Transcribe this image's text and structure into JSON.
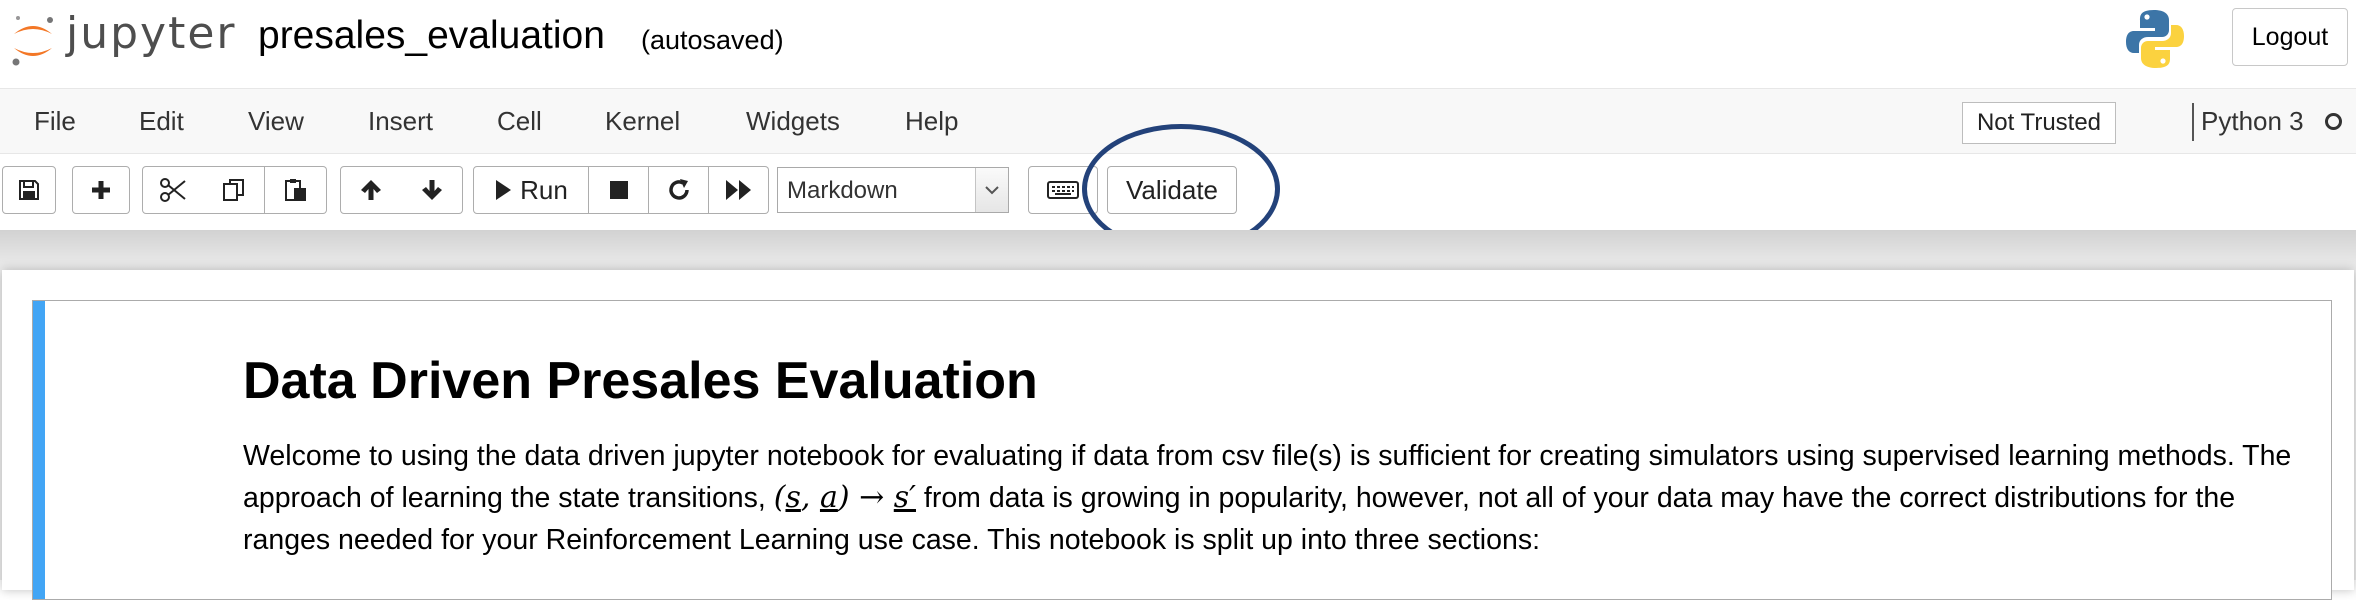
{
  "header": {
    "logo_text": "jupyter",
    "notebook_name": "presales_evaluation",
    "autosave_status": "(autosaved)",
    "logout_label": "Logout"
  },
  "menubar": {
    "items": [
      "File",
      "Edit",
      "View",
      "Insert",
      "Cell",
      "Kernel",
      "Widgets",
      "Help"
    ],
    "trust_label": "Not Trusted",
    "kernel_name": "Python 3"
  },
  "toolbar": {
    "run_label": "Run",
    "cell_type": "Markdown",
    "validate_label": "Validate"
  },
  "cell": {
    "heading": "Data Driven Presales Evaluation",
    "para_part1": "Welcome to using the data driven jupyter notebook for evaluating if data from csv file(s) is sufficient for creating simulators using supervised learning methods. The approach of learning the state transitions,",
    "math_s": "s",
    "math_a": "a",
    "math_s_prime": "s′",
    "para_part2": "from data is growing in popularity, however, not all of your data may have the correct distributions for the ranges needed for your Reinforcement Learning use case. This notebook is split up into three sections:"
  },
  "colors": {
    "accent_cell_selected": "#42a5f5",
    "highlight_ring": "#23427a",
    "jupyter_orange": "#f37726"
  }
}
